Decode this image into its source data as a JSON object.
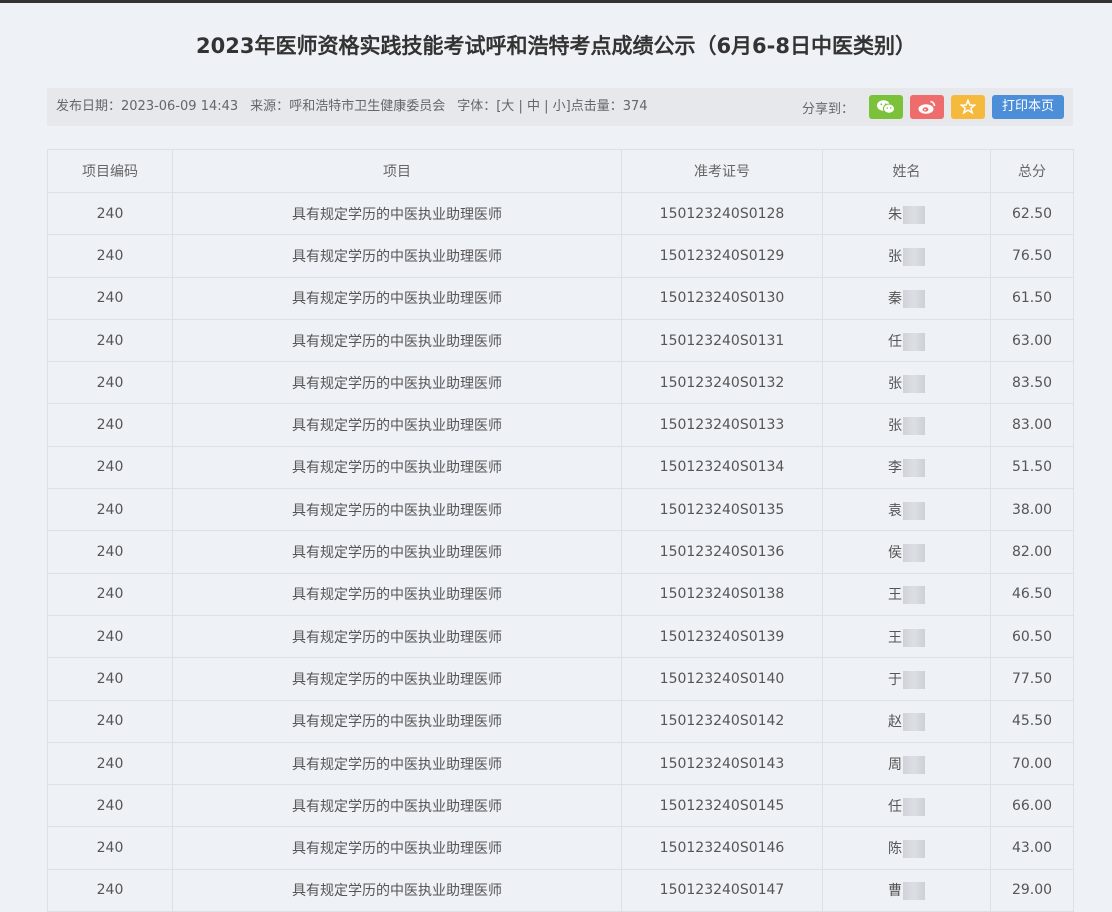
{
  "page": {
    "title": "2023年医师资格实践技能考试呼和浩特考点成绩公示（6月6-8日中医类别）"
  },
  "meta": {
    "publish_label": "发布日期：",
    "publish_date": "2023-06-09 14:43",
    "source_label": "来源：",
    "source": "呼和浩特市卫生健康委员会",
    "font_label": "字体：",
    "font_open": "[",
    "font_large": "大",
    "font_sep1": " | ",
    "font_medium": "中",
    "font_sep2": " | ",
    "font_small": "小",
    "font_close": "]",
    "clicks_label": "点击量：",
    "clicks": "374",
    "share_label": "分享到：",
    "print_label": "打印本页"
  },
  "colors": {
    "wechat": "#7bc13a",
    "weibo": "#ef6c6c",
    "favorite": "#f5b93e",
    "print": "#4d8ed9"
  },
  "icons": [
    "wechat-icon",
    "weibo-icon",
    "star-icon"
  ],
  "table": {
    "headers": [
      "项目编码",
      "项目",
      "准考证号",
      "姓名",
      "总分"
    ],
    "rows": [
      [
        "240",
        "具有规定学历的中医执业助理医师",
        "150123240S0128",
        "朱",
        "62.50"
      ],
      [
        "240",
        "具有规定学历的中医执业助理医师",
        "150123240S0129",
        "张",
        "76.50"
      ],
      [
        "240",
        "具有规定学历的中医执业助理医师",
        "150123240S0130",
        "秦",
        "61.50"
      ],
      [
        "240",
        "具有规定学历的中医执业助理医师",
        "150123240S0131",
        "任",
        "63.00"
      ],
      [
        "240",
        "具有规定学历的中医执业助理医师",
        "150123240S0132",
        "张",
        "83.50"
      ],
      [
        "240",
        "具有规定学历的中医执业助理医师",
        "150123240S0133",
        "张",
        "83.00"
      ],
      [
        "240",
        "具有规定学历的中医执业助理医师",
        "150123240S0134",
        "李",
        "51.50"
      ],
      [
        "240",
        "具有规定学历的中医执业助理医师",
        "150123240S0135",
        "袁",
        "38.00"
      ],
      [
        "240",
        "具有规定学历的中医执业助理医师",
        "150123240S0136",
        "侯",
        "82.00"
      ],
      [
        "240",
        "具有规定学历的中医执业助理医师",
        "150123240S0138",
        "王",
        "46.50"
      ],
      [
        "240",
        "具有规定学历的中医执业助理医师",
        "150123240S0139",
        "王",
        "60.50"
      ],
      [
        "240",
        "具有规定学历的中医执业助理医师",
        "150123240S0140",
        "于",
        "77.50"
      ],
      [
        "240",
        "具有规定学历的中医执业助理医师",
        "150123240S0142",
        "赵",
        "45.50"
      ],
      [
        "240",
        "具有规定学历的中医执业助理医师",
        "150123240S0143",
        "周",
        "70.00"
      ],
      [
        "240",
        "具有规定学历的中医执业助理医师",
        "150123240S0145",
        "任",
        "66.00"
      ],
      [
        "240",
        "具有规定学历的中医执业助理医师",
        "150123240S0146",
        "陈",
        "43.00"
      ],
      [
        "240",
        "具有规定学历的中医执业助理医师",
        "150123240S0147",
        "曹",
        "29.00"
      ]
    ]
  }
}
